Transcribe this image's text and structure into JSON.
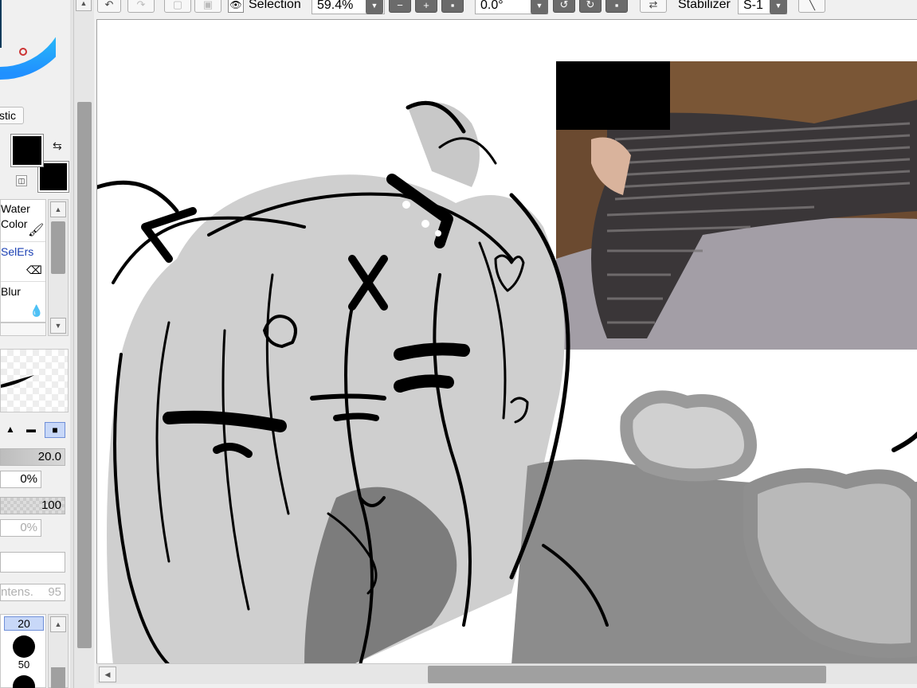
{
  "toolbar": {
    "selection_label": "Selection",
    "zoom_value": "59.4%",
    "rotation_value": "0.0°",
    "stabilizer_label": "Stabilizer",
    "stabilizer_value": "S-1"
  },
  "left_panel": {
    "mode_button_label": "stic",
    "tools": [
      {
        "line1": "Water",
        "line2": "Color"
      },
      {
        "line1": "SelErs"
      },
      {
        "line1": "Blur"
      }
    ],
    "brush_size": "20.0",
    "min_size": "0%",
    "density": "100",
    "min_density": "0%",
    "intensity_label": "ntens.",
    "intensity_value": "95",
    "size_presets": [
      "20",
      "50"
    ]
  },
  "colors": {
    "foreground": "#000000",
    "background": "#000000",
    "accent_selected": "#c8d8f8"
  },
  "icons": [
    "undo-icon",
    "redo-icon",
    "eye-icon",
    "minus-icon",
    "plus-icon",
    "rotate-left-icon",
    "rotate-right-icon",
    "flip-icon",
    "swap-colors-icon",
    "pen-icon"
  ]
}
